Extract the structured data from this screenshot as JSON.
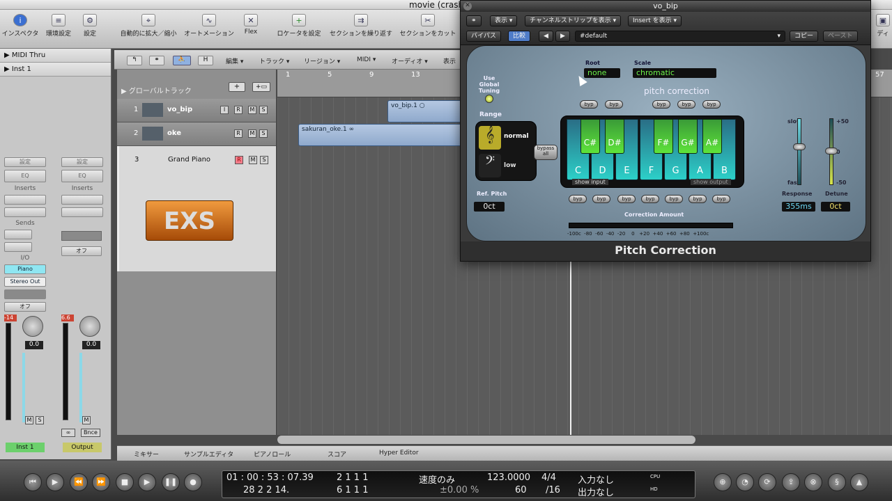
{
  "window": {
    "title": "movie (crashed) -"
  },
  "toolbar": {
    "items": [
      {
        "label": "インスペクタ",
        "icon": "info-icon"
      },
      {
        "label": "環境設定",
        "icon": "preferences-icon"
      },
      {
        "label": "設定",
        "icon": "settings-icon"
      },
      {
        "label": "自動的に拡大／縮小",
        "icon": "auto-zoom-icon"
      },
      {
        "label": "オートメーション",
        "icon": "automation-icon"
      },
      {
        "label": "Flex",
        "icon": "flex-icon"
      },
      {
        "label": "ロケータを設定",
        "icon": "set-locators-icon"
      },
      {
        "label": "セクションを繰り返す",
        "icon": "repeat-section-icon"
      },
      {
        "label": "セクションをカット",
        "icon": "cut-section-icon"
      }
    ],
    "right_label": "ディ"
  },
  "inspector": {
    "rows": [
      "MIDI Thru",
      "Inst 1"
    ],
    "strip1": {
      "setting": "設定",
      "eq": "EQ",
      "inserts": "Inserts",
      "sends": "Sends",
      "io": "I/O",
      "input": "Piano",
      "output": "Stereo Out",
      "off": "オフ",
      "peak": "-14",
      "value": "0.0",
      "m": "M",
      "s": "S",
      "name": "Inst 1"
    },
    "strip2": {
      "setting": "設定",
      "eq": "EQ",
      "inserts": "Inserts",
      "off": "オフ",
      "peak": "6.6",
      "value": "0.0",
      "m": "M",
      "bnce": "Bnce",
      "name": "Output"
    }
  },
  "arrange": {
    "menus": [
      "編集",
      "トラック",
      "リージョン",
      "MIDI",
      "オーディオ",
      "表示"
    ],
    "hdr_buttons": [
      "H"
    ],
    "global_tracks": "グローバルトラック",
    "ruler": [
      "1",
      "5",
      "9",
      "13",
      "57"
    ],
    "tracks": [
      {
        "num": "1",
        "name": "vo_bip",
        "btns": [
          "I",
          "R",
          "M",
          "S"
        ]
      },
      {
        "num": "2",
        "name": "oke",
        "btns": [
          "R",
          "M",
          "S"
        ]
      },
      {
        "num": "3",
        "name": "Grand Piano",
        "btns": [
          "R",
          "M",
          "S"
        ]
      }
    ],
    "exs_label": "EXS",
    "regions": [
      {
        "name": "vo_bip.1 ○"
      },
      {
        "name": "sakuran_oke.1 ∞"
      }
    ]
  },
  "bottom_tabs": [
    "ミキサー",
    "サンプルエディタ",
    "ピアノロール",
    "スコア",
    "Hyper Editor"
  ],
  "transport": {
    "time": "01 : 00 : 53 : 07.39",
    "smpte_sub": "28   2   2   14.",
    "bars_top": "2   1   1     1",
    "bars_bottom": "6   1   1     1",
    "mode": "速度のみ",
    "mode_sub": "±0.00 %",
    "tempo": "123.0000",
    "tempo_sub": "60",
    "sig": "4/4",
    "div": "/16",
    "in": "入力なし",
    "out": "出力なし",
    "cpu": "CPU",
    "hd": "HD"
  },
  "plugin": {
    "title": "vo_bip",
    "header_menus": [
      "表示",
      "チャンネルストリップを表示",
      "Insert を表示"
    ],
    "bypass": "バイパス",
    "compare": "比較",
    "preset": "#default",
    "copy": "コピー",
    "paste": "ペースト",
    "root_label": "Root",
    "root_value": "none",
    "scale_label": "Scale",
    "scale_value": "chromatic",
    "use_global": "Use Global Tuning",
    "range_label": "Range",
    "range_normal": "normal",
    "range_low": "low",
    "bypass_all": "bypass all",
    "pitch_correction_label": "pitch correction",
    "byp": "byp",
    "black_keys": [
      "C#",
      "D#",
      "F#",
      "G#",
      "A#"
    ],
    "white_keys": [
      "C",
      "D",
      "E",
      "F",
      "G",
      "A",
      "B"
    ],
    "show_input": "show input",
    "show_output": "show output",
    "ref_pitch_label": "Ref. Pitch",
    "ref_pitch_value": "0ct",
    "correction_amount": "Correction Amount",
    "scale_ticks": "-100c  -80  -60  -40  -20    0   +20  +40  +60  +80  +100c",
    "slow": "slow",
    "fast": "fast",
    "plus50": "+50",
    "zero": "0",
    "minus50": "-50",
    "response_label": "Response",
    "response_value": "355ms",
    "detune_label": "Detune",
    "detune_value": "0ct",
    "footer": "Pitch Correction",
    "colors": {
      "display_text": "#6cf24a",
      "white_key": "#2cd0c8",
      "black_key": "#5ee33a"
    }
  }
}
